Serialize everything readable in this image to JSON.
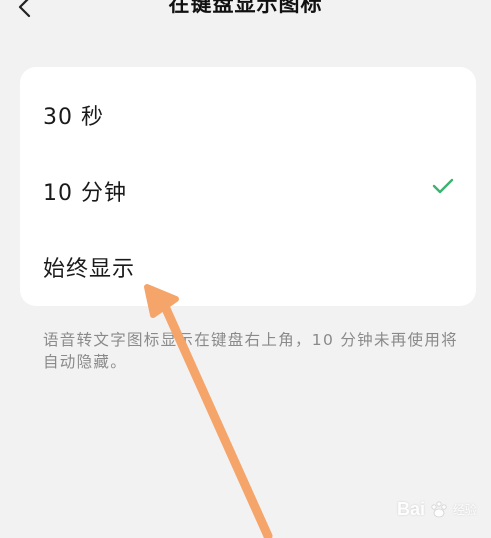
{
  "header": {
    "title": "在键盘显示图标",
    "back_icon": "chevron-left-icon"
  },
  "options": [
    {
      "label": "30 秒",
      "selected": false
    },
    {
      "label": "10 分钟",
      "selected": true
    },
    {
      "label": "始终显示",
      "selected": false
    }
  ],
  "description": "语音转文字图标显示在键盘右上角，10 分钟未再使用将自动隐藏。",
  "colors": {
    "check": "#3cb371",
    "annotation_arrow": "#f5a46a",
    "background": "#f2f2f2",
    "card": "#ffffff"
  },
  "watermark": {
    "brand": "Bai",
    "sub": "经验"
  }
}
